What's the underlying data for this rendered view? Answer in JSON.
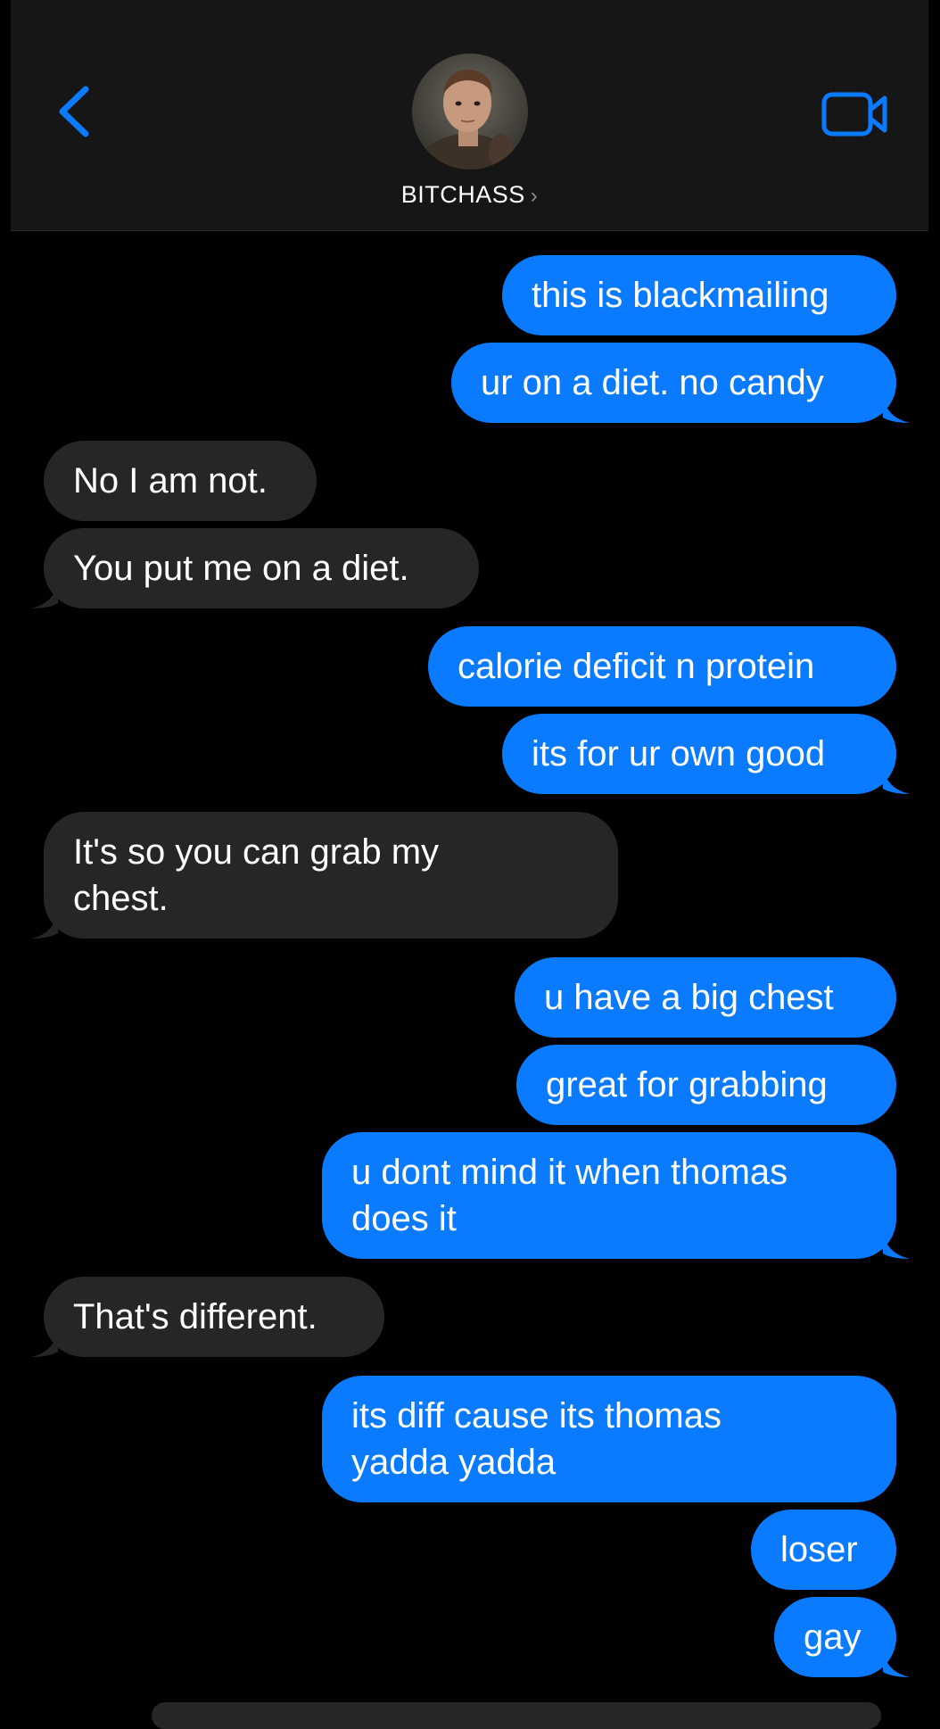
{
  "header": {
    "contact_name": "BITCHASS",
    "chevron": "›",
    "icons": {
      "back": "chevron-left-icon",
      "video": "video-camera-icon"
    },
    "accent_color": "#0A7BFF",
    "background_color": "#161616"
  },
  "messages": [
    {
      "from": "me",
      "text": "this is blackmailing"
    },
    {
      "from": "me",
      "text": "ur on a diet. no candy"
    },
    {
      "from": "them",
      "text": "No I am not."
    },
    {
      "from": "them",
      "text": "You put me on a diet."
    },
    {
      "from": "me",
      "text": "calorie deficit n protein"
    },
    {
      "from": "me",
      "text": "its for ur own good"
    },
    {
      "from": "them",
      "text": "It's so you can grab my\nchest."
    },
    {
      "from": "me",
      "text": "u have a big chest"
    },
    {
      "from": "me",
      "text": "great for grabbing"
    },
    {
      "from": "me",
      "text": "u dont mind it when thomas\ndoes it"
    },
    {
      "from": "them",
      "text": "That's different."
    },
    {
      "from": "me",
      "text": "its diff cause its thomas\nyadda yadda"
    },
    {
      "from": "me",
      "text": "loser"
    },
    {
      "from": "me",
      "text": "gay"
    }
  ],
  "colors": {
    "outgoing_bubble": "#0A7BFF",
    "incoming_bubble": "#262628",
    "background": "#000000"
  }
}
